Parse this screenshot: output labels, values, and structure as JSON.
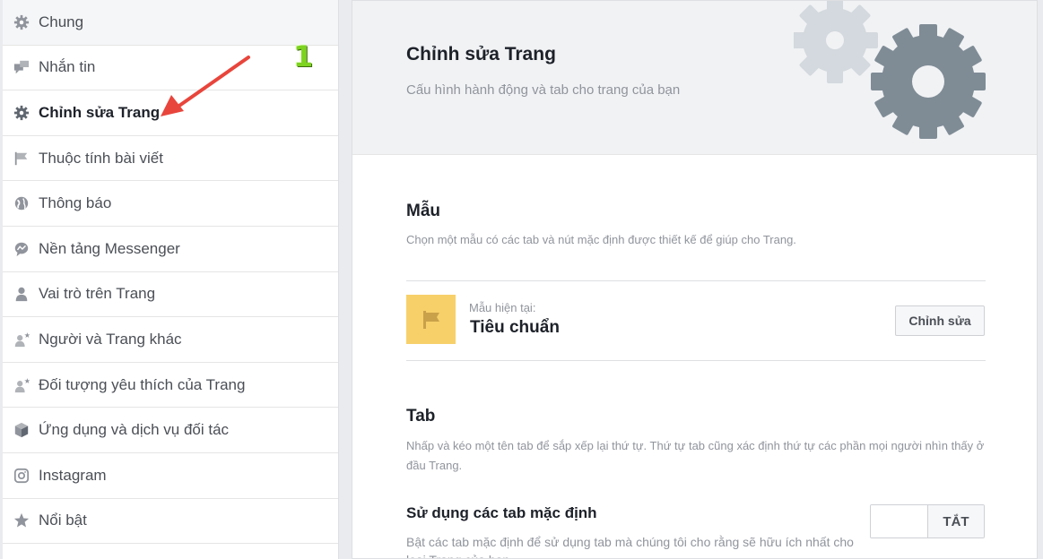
{
  "sidebar": {
    "items": [
      {
        "label": "Chung",
        "icon": "gear-icon"
      },
      {
        "label": "Nhắn tin",
        "icon": "chat-bubbles-icon"
      },
      {
        "label": "Chỉnh sửa Trang",
        "icon": "gear-icon"
      },
      {
        "label": "Thuộc tính bài viết",
        "icon": "flag-icon"
      },
      {
        "label": "Thông báo",
        "icon": "globe-icon"
      },
      {
        "label": "Nền tảng Messenger",
        "icon": "messenger-icon"
      },
      {
        "label": "Vai trò trên Trang",
        "icon": "person-icon"
      },
      {
        "label": "Người và Trang khác",
        "icon": "person-star-icon"
      },
      {
        "label": "Đối tượng yêu thích của Trang",
        "icon": "person-star-icon"
      },
      {
        "label": "Ứng dụng và dịch vụ đối tác",
        "icon": "cube-icon"
      },
      {
        "label": "Instagram",
        "icon": "instagram-icon"
      },
      {
        "label": "Nổi bật",
        "icon": "star-icon"
      }
    ]
  },
  "annotation": {
    "number": "1",
    "color": "#7ed320",
    "arrow_color": "#e8453c"
  },
  "header": {
    "title": "Chỉnh sửa Trang",
    "subtitle": "Cấu hình hành động và tab cho trang của bạn"
  },
  "template_section": {
    "title": "Mẫu",
    "description": "Chọn một mẫu có các tab và nút mặc định được thiết kế để giúp cho Trang.",
    "current_caption": "Mẫu hiện tại:",
    "current_value": "Tiêu chuẩn",
    "edit_label": "Chỉnh sửa",
    "icon_color": "#f7d06a"
  },
  "tab_section": {
    "title": "Tab",
    "description": "Nhấp và kéo một tên tab để sắp xếp lại thứ tự. Thứ tự tab cũng xác định thứ tự các phần mọi người nhìn thấy ở đầu Trang.",
    "default_tabs_title": "Sử dụng các tab mặc định",
    "default_tabs_desc": "Bật các tab mặc định để sử dụng tab mà chúng tôi cho rằng sẽ hữu ích nhất cho loại Trang của bạn.",
    "toggle_label": "TẮT"
  },
  "colors": {
    "gear_light": "#d3d9de",
    "gear_dark": "#7f8c96"
  }
}
